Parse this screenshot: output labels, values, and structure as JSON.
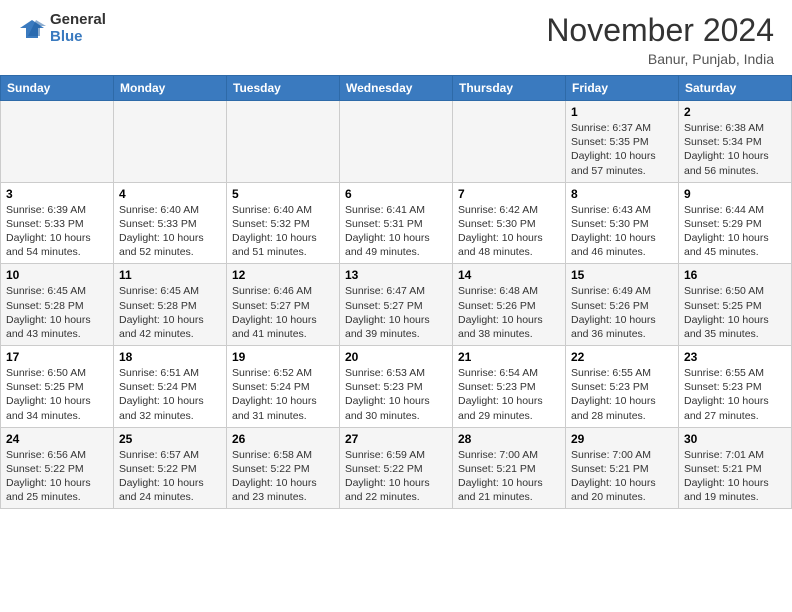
{
  "header": {
    "logo": {
      "general": "General",
      "blue": "Blue"
    },
    "title": "November 2024",
    "location": "Banur, Punjab, India"
  },
  "calendar": {
    "days_of_week": [
      "Sunday",
      "Monday",
      "Tuesday",
      "Wednesday",
      "Thursday",
      "Friday",
      "Saturday"
    ],
    "weeks": [
      [
        {
          "day": "",
          "info": ""
        },
        {
          "day": "",
          "info": ""
        },
        {
          "day": "",
          "info": ""
        },
        {
          "day": "",
          "info": ""
        },
        {
          "day": "",
          "info": ""
        },
        {
          "day": "1",
          "info": "Sunrise: 6:37 AM\nSunset: 5:35 PM\nDaylight: 10 hours and 57 minutes."
        },
        {
          "day": "2",
          "info": "Sunrise: 6:38 AM\nSunset: 5:34 PM\nDaylight: 10 hours and 56 minutes."
        }
      ],
      [
        {
          "day": "3",
          "info": "Sunrise: 6:39 AM\nSunset: 5:33 PM\nDaylight: 10 hours and 54 minutes."
        },
        {
          "day": "4",
          "info": "Sunrise: 6:40 AM\nSunset: 5:33 PM\nDaylight: 10 hours and 52 minutes."
        },
        {
          "day": "5",
          "info": "Sunrise: 6:40 AM\nSunset: 5:32 PM\nDaylight: 10 hours and 51 minutes."
        },
        {
          "day": "6",
          "info": "Sunrise: 6:41 AM\nSunset: 5:31 PM\nDaylight: 10 hours and 49 minutes."
        },
        {
          "day": "7",
          "info": "Sunrise: 6:42 AM\nSunset: 5:30 PM\nDaylight: 10 hours and 48 minutes."
        },
        {
          "day": "8",
          "info": "Sunrise: 6:43 AM\nSunset: 5:30 PM\nDaylight: 10 hours and 46 minutes."
        },
        {
          "day": "9",
          "info": "Sunrise: 6:44 AM\nSunset: 5:29 PM\nDaylight: 10 hours and 45 minutes."
        }
      ],
      [
        {
          "day": "10",
          "info": "Sunrise: 6:45 AM\nSunset: 5:28 PM\nDaylight: 10 hours and 43 minutes."
        },
        {
          "day": "11",
          "info": "Sunrise: 6:45 AM\nSunset: 5:28 PM\nDaylight: 10 hours and 42 minutes."
        },
        {
          "day": "12",
          "info": "Sunrise: 6:46 AM\nSunset: 5:27 PM\nDaylight: 10 hours and 41 minutes."
        },
        {
          "day": "13",
          "info": "Sunrise: 6:47 AM\nSunset: 5:27 PM\nDaylight: 10 hours and 39 minutes."
        },
        {
          "day": "14",
          "info": "Sunrise: 6:48 AM\nSunset: 5:26 PM\nDaylight: 10 hours and 38 minutes."
        },
        {
          "day": "15",
          "info": "Sunrise: 6:49 AM\nSunset: 5:26 PM\nDaylight: 10 hours and 36 minutes."
        },
        {
          "day": "16",
          "info": "Sunrise: 6:50 AM\nSunset: 5:25 PM\nDaylight: 10 hours and 35 minutes."
        }
      ],
      [
        {
          "day": "17",
          "info": "Sunrise: 6:50 AM\nSunset: 5:25 PM\nDaylight: 10 hours and 34 minutes."
        },
        {
          "day": "18",
          "info": "Sunrise: 6:51 AM\nSunset: 5:24 PM\nDaylight: 10 hours and 32 minutes."
        },
        {
          "day": "19",
          "info": "Sunrise: 6:52 AM\nSunset: 5:24 PM\nDaylight: 10 hours and 31 minutes."
        },
        {
          "day": "20",
          "info": "Sunrise: 6:53 AM\nSunset: 5:23 PM\nDaylight: 10 hours and 30 minutes."
        },
        {
          "day": "21",
          "info": "Sunrise: 6:54 AM\nSunset: 5:23 PM\nDaylight: 10 hours and 29 minutes."
        },
        {
          "day": "22",
          "info": "Sunrise: 6:55 AM\nSunset: 5:23 PM\nDaylight: 10 hours and 28 minutes."
        },
        {
          "day": "23",
          "info": "Sunrise: 6:55 AM\nSunset: 5:23 PM\nDaylight: 10 hours and 27 minutes."
        }
      ],
      [
        {
          "day": "24",
          "info": "Sunrise: 6:56 AM\nSunset: 5:22 PM\nDaylight: 10 hours and 25 minutes."
        },
        {
          "day": "25",
          "info": "Sunrise: 6:57 AM\nSunset: 5:22 PM\nDaylight: 10 hours and 24 minutes."
        },
        {
          "day": "26",
          "info": "Sunrise: 6:58 AM\nSunset: 5:22 PM\nDaylight: 10 hours and 23 minutes."
        },
        {
          "day": "27",
          "info": "Sunrise: 6:59 AM\nSunset: 5:22 PM\nDaylight: 10 hours and 22 minutes."
        },
        {
          "day": "28",
          "info": "Sunrise: 7:00 AM\nSunset: 5:21 PM\nDaylight: 10 hours and 21 minutes."
        },
        {
          "day": "29",
          "info": "Sunrise: 7:00 AM\nSunset: 5:21 PM\nDaylight: 10 hours and 20 minutes."
        },
        {
          "day": "30",
          "info": "Sunrise: 7:01 AM\nSunset: 5:21 PM\nDaylight: 10 hours and 19 minutes."
        }
      ]
    ]
  }
}
